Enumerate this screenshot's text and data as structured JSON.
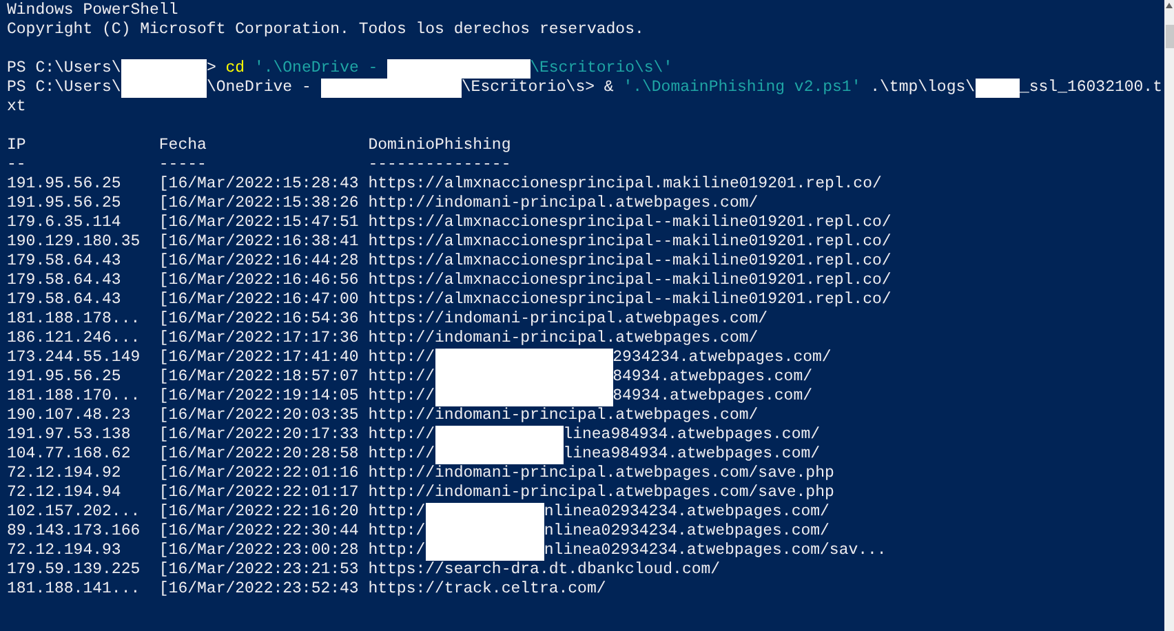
{
  "console": {
    "lines": [
      {
        "kind": "text",
        "text": "Windows PowerShell"
      },
      {
        "kind": "text",
        "text": "Copyright (C) Microsoft Corporation. Todos los derechos reservados."
      },
      {
        "kind": "blank"
      },
      {
        "kind": "segments",
        "parts": [
          {
            "kind": "text",
            "color": "#eeedf0",
            "text": "PS C:\\Users\\"
          },
          {
            "kind": "redacted"
          },
          {
            "kind": "text",
            "color": "#eeedf0",
            "text": "> "
          },
          {
            "kind": "text",
            "color": "#ffff00",
            "text": "cd"
          },
          {
            "kind": "text",
            "color": "#1fa5a5",
            "text": "'.\\OneDrive - "
          },
          {
            "kind": "redacted"
          },
          {
            "kind": "text",
            "color": "#1fa5a5",
            "text": "\\Escritorio\\s\\'"
          }
        ]
      },
      {
        "kind": "segments",
        "parts": [
          {
            "kind": "text",
            "color": "#eeedf0",
            "text": "PS C:\\Users\\"
          },
          {
            "kind": "redacted"
          },
          {
            "kind": "text",
            "color": "#eeedf0",
            "text": "\\OneDrive - "
          },
          {
            "kind": "redacted"
          },
          {
            "kind": "text",
            "color": "#eeedf0",
            "text": "\\Escritorio\\s> &"
          },
          {
            "kind": "text",
            "color": "#1fa5a5",
            "text": "'.\\DomainPhishing v2.ps1'"
          },
          {
            "kind": "text",
            "color": "#eeedf0",
            "text": ".\\tmp\\logs\\"
          },
          {
            "kind": "redacted"
          },
          {
            "kind": "text",
            "color": "#eeedf0",
            "text": "_ssl_16032100.t"
          }
        ]
      },
      {
        "kind": "text",
        "text": "xt"
      },
      {
        "kind": "blank"
      }
    ],
    "table": {
      "columns": [
        "IP",
        "Fecha",
        "DominioPhishing"
      ],
      "rules": [
        "--",
        "-----",
        "---------------"
      ],
      "rows": [
        {
          "ip": "191.95.56.25",
          "fecha": "[16/Mar/2022:15:28:43",
          "dominio": [
            {
              "kind": "text",
              "text": "https://almxnaccionesprincipal.makiline019201.repl.co/"
            }
          ]
        },
        {
          "ip": "191.95.56.25",
          "fecha": "[16/Mar/2022:15:38:26",
          "dominio": [
            {
              "kind": "text",
              "text": "http://indomani-principal.atwebpages.com/"
            }
          ]
        },
        {
          "ip": "179.6.35.114",
          "fecha": "[16/Mar/2022:15:47:51",
          "dominio": [
            {
              "kind": "text",
              "text": "https://almxnaccionesprincipal--makiline019201.repl.co/"
            }
          ]
        },
        {
          "ip": "190.129.180.35",
          "fecha": "[16/Mar/2022:16:38:41",
          "dominio": [
            {
              "kind": "text",
              "text": "https://almxnaccionesprincipal--makiline019201.repl.co/"
            }
          ]
        },
        {
          "ip": "179.58.64.43",
          "fecha": "[16/Mar/2022:16:44:28",
          "dominio": [
            {
              "kind": "text",
              "text": "https://almxnaccionesprincipal--makiline019201.repl.co/"
            }
          ]
        },
        {
          "ip": "179.58.64.43",
          "fecha": "[16/Mar/2022:16:46:56",
          "dominio": [
            {
              "kind": "text",
              "text": "https://almxnaccionesprincipal--makiline019201.repl.co/"
            }
          ]
        },
        {
          "ip": "179.58.64.43",
          "fecha": "[16/Mar/2022:16:47:00",
          "dominio": [
            {
              "kind": "text",
              "text": "https://almxnaccionesprincipal--makiline019201.repl.co/"
            }
          ]
        },
        {
          "ip": "181.188.178...",
          "fecha": "[16/Mar/2022:16:54:36",
          "dominio": [
            {
              "kind": "text",
              "text": "https://indomani-principal.atwebpages.com/"
            }
          ]
        },
        {
          "ip": "186.121.246...",
          "fecha": "[16/Mar/2022:17:17:36",
          "dominio": [
            {
              "kind": "text",
              "text": "http://indomani-principal.atwebpages.com/"
            }
          ]
        },
        {
          "ip": "173.244.55.149",
          "fecha": "[16/Mar/2022:17:41:40",
          "dominio": [
            {
              "kind": "text",
              "text": "http://"
            },
            {
              "kind": "redacted"
            },
            {
              "kind": "text",
              "text": "2934234.atwebpages.com/"
            }
          ]
        },
        {
          "ip": "191.95.56.25",
          "fecha": "[16/Mar/2022:18:57:07",
          "dominio": [
            {
              "kind": "text",
              "text": "http://"
            },
            {
              "kind": "redacted"
            },
            {
              "kind": "text",
              "text": "84934.atwebpages.com/"
            }
          ]
        },
        {
          "ip": "181.188.170...",
          "fecha": "[16/Mar/2022:19:14:05",
          "dominio": [
            {
              "kind": "text",
              "text": "http://"
            },
            {
              "kind": "redacted"
            },
            {
              "kind": "text",
              "text": "84934.atwebpages.com/"
            }
          ]
        },
        {
          "ip": "190.107.48.23",
          "fecha": "[16/Mar/2022:20:03:35",
          "dominio": [
            {
              "kind": "text",
              "text": "http://indomani-principal.atwebpages.com/"
            }
          ]
        },
        {
          "ip": "191.97.53.138",
          "fecha": "[16/Mar/2022:20:17:33",
          "dominio": [
            {
              "kind": "text",
              "text": "http://"
            },
            {
              "kind": "redacted"
            },
            {
              "kind": "text",
              "text": "linea984934.atwebpages.com/"
            }
          ]
        },
        {
          "ip": "104.77.168.62",
          "fecha": "[16/Mar/2022:20:28:58",
          "dominio": [
            {
              "kind": "text",
              "text": "http://"
            },
            {
              "kind": "redacted"
            },
            {
              "kind": "text",
              "text": "linea984934.atwebpages.com/"
            }
          ]
        },
        {
          "ip": "72.12.194.92",
          "fecha": "[16/Mar/2022:22:01:16",
          "dominio": [
            {
              "kind": "text",
              "text": "http://indomani-principal.atwebpages.com/save.php"
            }
          ]
        },
        {
          "ip": "72.12.194.94",
          "fecha": "[16/Mar/2022:22:01:17",
          "dominio": [
            {
              "kind": "text",
              "text": "http://indomani-principal.atwebpages.com/save.php"
            }
          ]
        },
        {
          "ip": "102.157.202...",
          "fecha": "[16/Mar/2022:22:16:20",
          "dominio": [
            {
              "kind": "text",
              "text": "http:/"
            },
            {
              "kind": "redacted"
            },
            {
              "kind": "text",
              "text": "nlinea02934234.atwebpages.com/"
            }
          ]
        },
        {
          "ip": "89.143.173.166",
          "fecha": "[16/Mar/2022:22:30:44",
          "dominio": [
            {
              "kind": "text",
              "text": "http:/"
            },
            {
              "kind": "redacted"
            },
            {
              "kind": "text",
              "text": "nlinea02934234.atwebpages.com/"
            }
          ]
        },
        {
          "ip": "72.12.194.93",
          "fecha": "[16/Mar/2022:23:00:28",
          "dominio": [
            {
              "kind": "text",
              "text": "http:/"
            },
            {
              "kind": "redacted"
            },
            {
              "kind": "text",
              "text": "nlinea02934234.atwebpages.com/sav..."
            }
          ]
        },
        {
          "ip": "179.59.139.225",
          "fecha": "[16/Mar/2022:23:21:53",
          "dominio": [
            {
              "kind": "text",
              "text": "https://search-dra.dt.dbankcloud.com/"
            }
          ]
        },
        {
          "ip": "181.188.141...",
          "fecha": "[16/Mar/2022:23:52:43",
          "dominio": [
            {
              "kind": "text",
              "text": "https://track.celtra.com/"
            }
          ]
        }
      ]
    }
  }
}
